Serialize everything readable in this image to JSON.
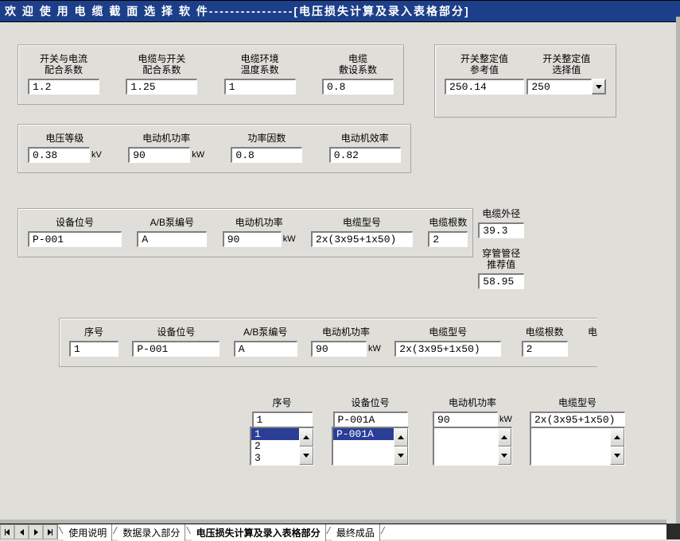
{
  "title": "欢 迎 使 用 电 缆 截 面 选 择 软 件----------------[电压损失计算及录入表格部分]",
  "coef": {
    "switch_current_label": "开关与电流\n配合系数",
    "switch_current_value": "1.2",
    "cable_switch_label": "电缆与开关\n配合系数",
    "cable_switch_value": "1.25",
    "cable_env_label": "电缆环境\n温度系数",
    "cable_env_value": "1",
    "cable_lay_label": "电缆\n敷设系数",
    "cable_lay_value": "0.8"
  },
  "switch_ref": {
    "ref_label": "开关整定值\n参考值",
    "ref_value": "250.14",
    "sel_label": "开关整定值\n选择值",
    "sel_value": "250"
  },
  "power": {
    "voltage_label": "电压等级",
    "voltage_value": "0.38",
    "voltage_unit": "kV",
    "motor_power_label": "电动机功率",
    "motor_power_value": "90",
    "motor_power_unit": "kW",
    "pf_label": "功率因数",
    "pf_value": "0.8",
    "eff_label": "电动机效率",
    "eff_value": "0.82"
  },
  "device": {
    "device_no_label": "设备位号",
    "device_no_value": "P-001",
    "pump_label": "A/B泵编号",
    "pump_value": "A",
    "motor_power_label": "电动机功率",
    "motor_power_value": "90",
    "motor_power_unit": "kW",
    "cable_type_label": "电缆型号",
    "cable_type_value": "2x(3x95+1x50)",
    "cable_count_label": "电缆根数",
    "cable_count_value": "2",
    "cable_od_label": "电缆外径",
    "cable_od_value": "39.3",
    "pipe_label": "穿管管径\n推荐值",
    "pipe_value": "58.95"
  },
  "line": {
    "seq_label": "序号",
    "seq_value": "1",
    "device_no_label": "设备位号",
    "device_no_value": "P-001",
    "pump_label": "A/B泵编号",
    "pump_value": "A",
    "motor_power_label": "电动机功率",
    "motor_power_value": "90",
    "motor_power_unit": "kW",
    "cable_type_label": "电缆型号",
    "cable_type_value": "2x(3x95+1x50)",
    "cable_count_label": "电缆根数",
    "cable_count_value": "2",
    "extra_label": "电"
  },
  "lists": {
    "seq_label": "序号",
    "seq_value": "1",
    "seq_options": [
      "1",
      "2",
      "3"
    ],
    "seq_selected": "1",
    "device_label": "设备位号",
    "device_value": "P-001A",
    "device_options": [
      "P-001A"
    ],
    "device_selected": "P-001A",
    "motor_label": "电动机功率",
    "motor_value": "90",
    "motor_unit": "kW",
    "cable_label": "电缆型号",
    "cable_value": "2x(3x95+1x50)"
  },
  "tabs": {
    "t1": "使用说明",
    "t2": "数据录入部分",
    "t3": "电压损失计算及录入表格部分",
    "t4": "最终成品"
  }
}
